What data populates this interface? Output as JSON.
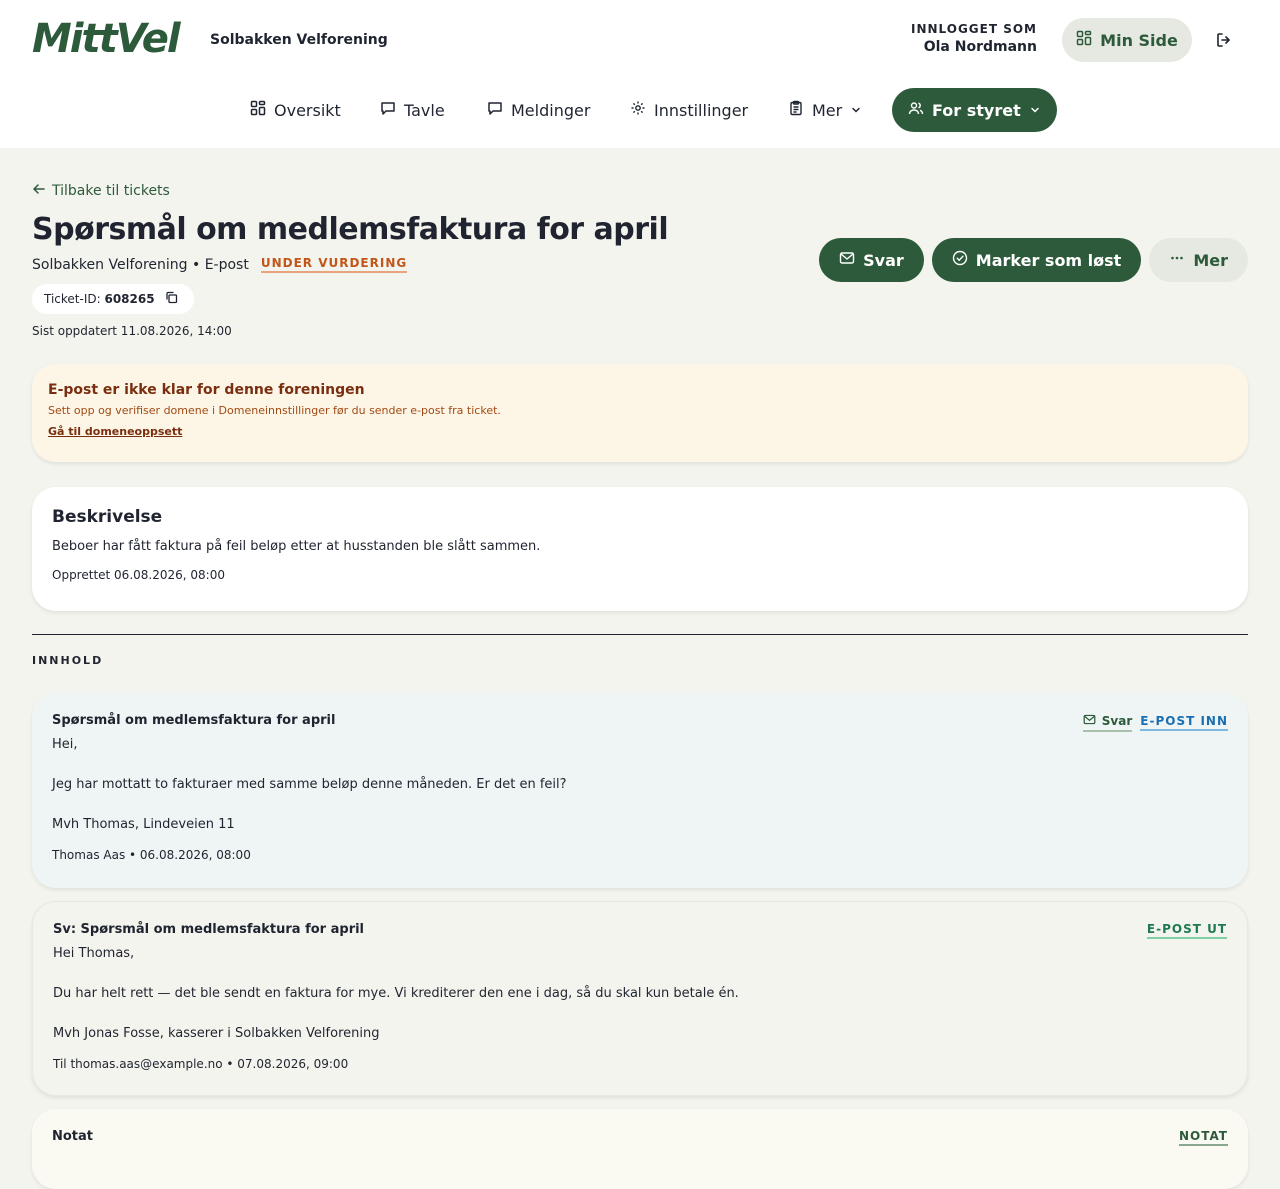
{
  "header": {
    "logo": "MittVel",
    "org_name": "Solbakken Velforening",
    "login_label": "INNLOGGET SOM",
    "login_user": "Ola Nordmann",
    "min_side": "Min Side"
  },
  "nav": {
    "items": [
      {
        "label": "Oversikt",
        "icon": "grid-icon"
      },
      {
        "label": "Tavle",
        "icon": "chat-bubble-icon"
      },
      {
        "label": "Meldinger",
        "icon": "chat-bubble-icon"
      },
      {
        "label": "Innstillinger",
        "icon": "gear-icon"
      },
      {
        "label": "Mer",
        "icon": "clipboard-icon"
      }
    ],
    "board_label": "For styret"
  },
  "ticket": {
    "back_label": "Tilbake til tickets",
    "title": "Spørsmål om medlemsfaktura for april",
    "meta": "Solbakken Velforening • E-post",
    "status": "UNDER VURDERING",
    "id_label": "Ticket-ID:",
    "id_value": "608265",
    "updated": "Sist oppdatert 11.08.2026, 14:00"
  },
  "actions": {
    "reply": "Svar",
    "resolve": "Marker som løst",
    "more": "Mer"
  },
  "warning": {
    "title": "E-post er ikke klar for denne foreningen",
    "text": "Sett opp og verifiser domene i Domeneinnstillinger før du sender e-post fra ticket.",
    "link": "Gå til domeneoppsett"
  },
  "description": {
    "heading": "Beskrivelse",
    "body": "Beboer har fått faktura på feil beløp etter at husstanden ble slått sammen.",
    "created": "Opprettet 06.08.2026, 08:00"
  },
  "content": {
    "section_label": "INNHOLD",
    "messages": [
      {
        "subject": "Spørsmål om medlemsfaktura for april",
        "lines": [
          "Hei,",
          "Jeg har mottatt to fakturaer med samme beløp denne måneden. Er det en feil?",
          "Mvh Thomas, Lindeveien 11"
        ],
        "meta": "Thomas Aas • 06.08.2026, 08:00",
        "reply_tag": "Svar",
        "tag": "E-POST INN"
      },
      {
        "subject": "Sv: Spørsmål om medlemsfaktura for april",
        "lines": [
          "Hei Thomas,",
          "Du har helt rett — det ble sendt en faktura for mye. Vi krediterer den ene i dag, så du skal kun betale én.",
          "Mvh Jonas Fosse, kasserer i Solbakken Velforening"
        ],
        "meta": "Til thomas.aas@example.no • 07.08.2026, 09:00",
        "tag": "E-POST UT"
      },
      {
        "subject": "Notat",
        "tag": "NOTAT"
      }
    ]
  },
  "colors": {
    "brand": "#2d5a3a",
    "status": "#c2561a",
    "tag_in": "#1b6fb0",
    "tag_out": "#1e7a4e"
  }
}
